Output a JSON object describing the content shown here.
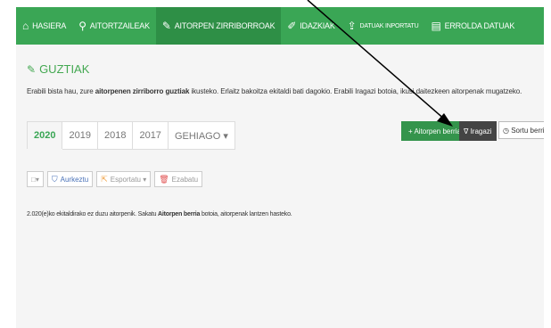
{
  "nav": {
    "items": [
      {
        "label": "HASIERA",
        "icon": "⌂"
      },
      {
        "label": "AITORTZAILEAK",
        "icon": "⚲"
      },
      {
        "label": "AITORPEN ZIRRIBORROAK",
        "icon": "✎"
      },
      {
        "label": "IDAZKIAK",
        "icon": "✐"
      },
      {
        "label": "DATUAK INPORTATU",
        "icon": "⇪"
      },
      {
        "label": "ERROLDA DATUAK",
        "icon": "▤"
      }
    ]
  },
  "section": {
    "title": "GUZTIAK",
    "desc_before": "Erabili bista hau, zure ",
    "desc_bold": "aitorpenen zirriborro guztiak",
    "desc_after": " ikusteko. Erlaitz bakoitza ekitaldi bati dagokio. Erabili Iragazi botoia, ikusi daitezkeen aitorpenak mugatzeko."
  },
  "tabs": [
    "2020",
    "2019",
    "2018",
    "2017",
    "GEHIAGO ▾"
  ],
  "actions": {
    "new": "+ Aitorpen berria",
    "filter": "∇ Iragazi",
    "sort": "◷ Sortu berriak"
  },
  "toolbar": {
    "select": "□▾",
    "refresh": "Aurkeztu",
    "export": "Esportatu ▾",
    "delete": "Ezabatu"
  },
  "empty": {
    "before": "2.020(e)ko ekitaldirako ez duzu aitorpenik. Sakatu ",
    "bold": "Aitorpen berria",
    "after": " botoia, aitorpenak lantzen hasteko."
  },
  "colors": {
    "accent": "#3aa655",
    "dark": "#2e8f46"
  }
}
